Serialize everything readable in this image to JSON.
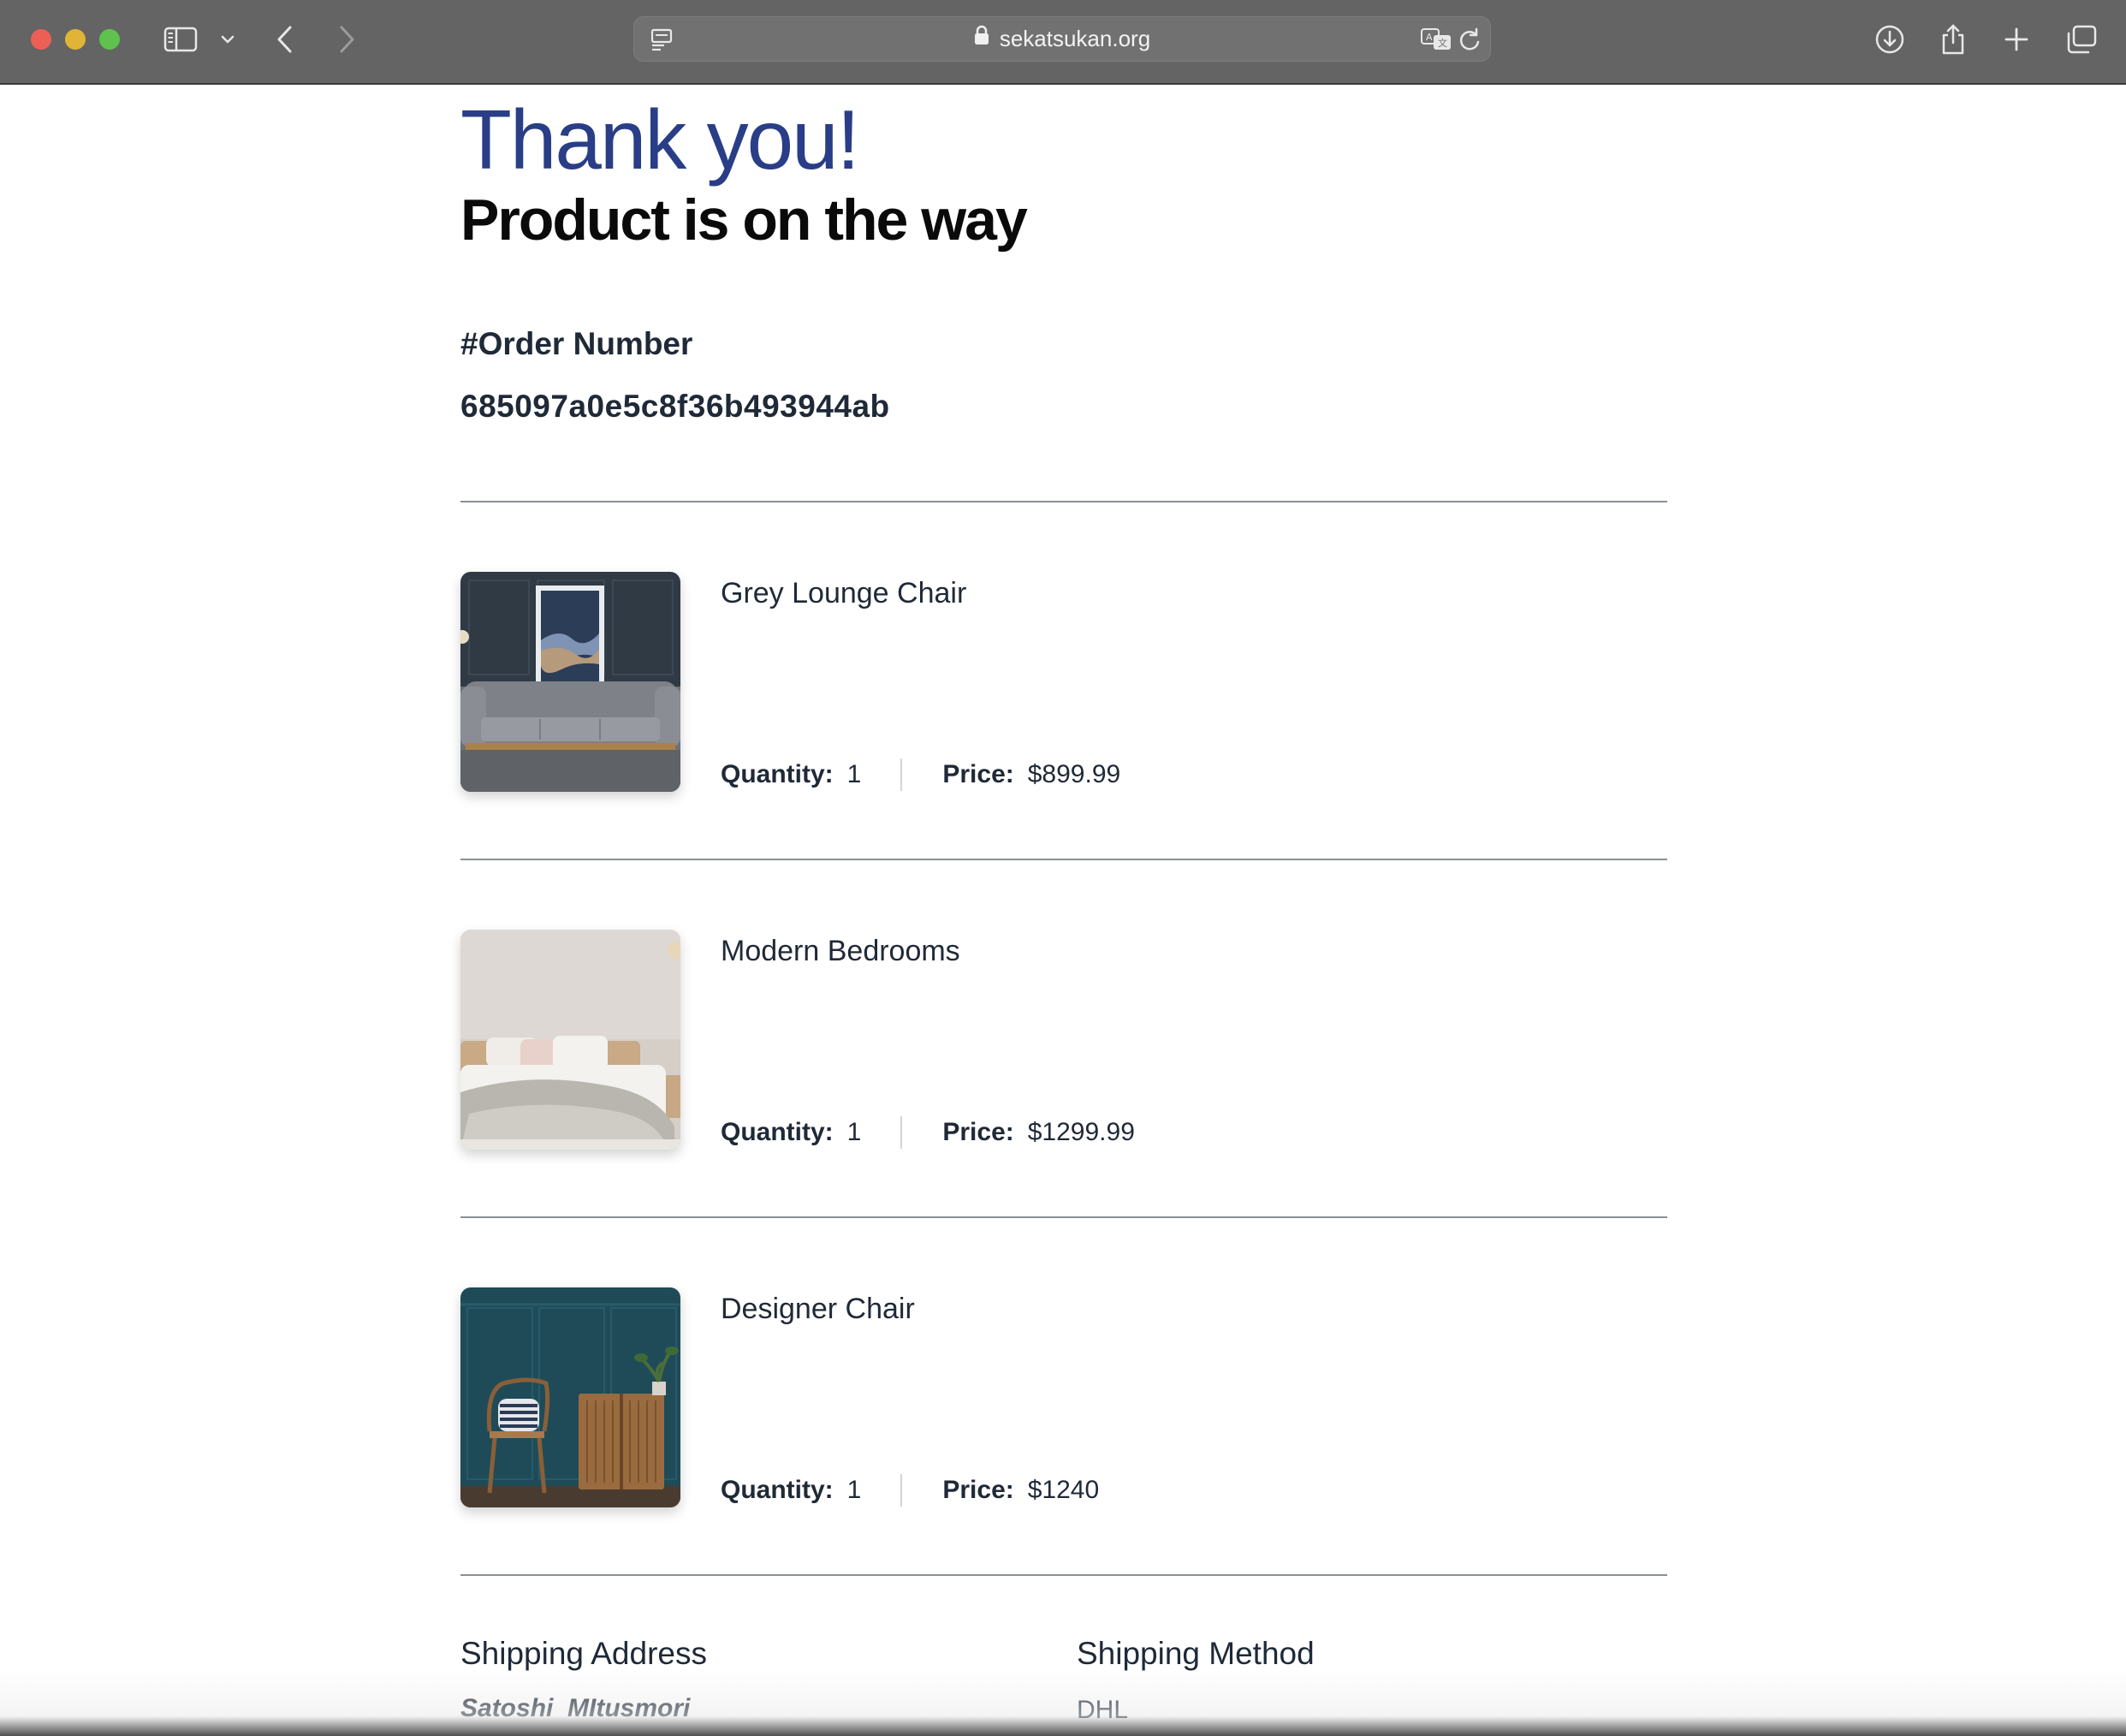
{
  "browser": {
    "url": "sekatsukan.org",
    "icons": [
      "sidebar-icon",
      "chevron-down-icon",
      "back-icon",
      "forward-icon",
      "reader-icon",
      "lock-icon",
      "translate-icon",
      "reload-icon",
      "download-icon",
      "share-icon",
      "new-tab-icon",
      "tabs-overview-icon"
    ]
  },
  "page": {
    "thank_you": "Thank you!",
    "subtitle": "Product is on the way",
    "order_label": "#Order Number",
    "order_number": "685097a0e5c8f36b493944ab"
  },
  "labels": {
    "quantity": "Quantity:",
    "price": "Price:"
  },
  "items": [
    {
      "name": "Grey Lounge Chair",
      "quantity": "1",
      "price": "$899.99"
    },
    {
      "name": "Modern Bedrooms",
      "quantity": "1",
      "price": "$1299.99"
    },
    {
      "name": "Designer Chair",
      "quantity": "1",
      "price": "$1240"
    }
  ],
  "shipping": {
    "address_heading": "Shipping Address",
    "first_name": "Satoshi",
    "last_name": "MItusmori",
    "method_heading": "Shipping Method",
    "method": "DHL"
  },
  "colors": {
    "accent": "#293e86",
    "chrome": "#636463"
  }
}
